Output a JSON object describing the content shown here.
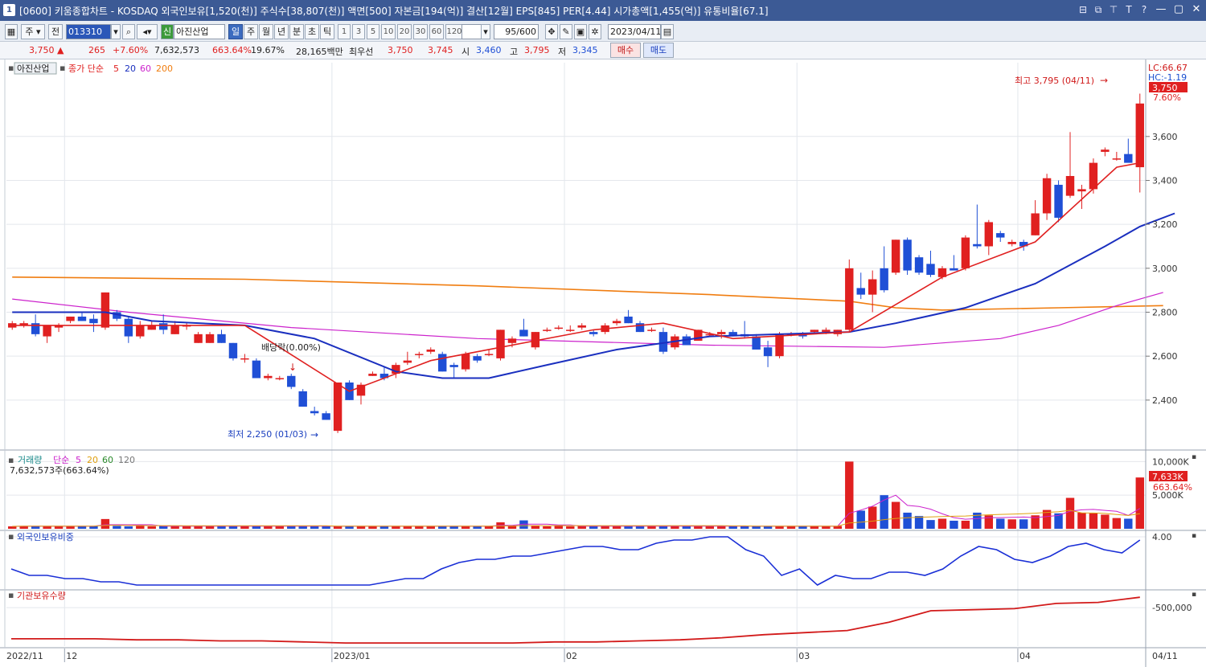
{
  "titlebar": {
    "window_number": "1",
    "title": "[0600] 키움종합차트 - KOSDAQ 외국인보유[1,520(천)] 주식수[38,807(천)] 액면[500] 자본금[194(억)] 결산[12월] EPS[845] PER[4.44] 시가총액[1,455(억)] 유통비율[67.1]",
    "icons": [
      "grid-icon",
      "window-icon",
      "pin-icon",
      "text-icon",
      "help-icon"
    ],
    "icon_glyphs": [
      "⊟",
      "⧉",
      "⊤",
      "T",
      "?"
    ],
    "controls": [
      "—",
      "▢",
      "✕"
    ]
  },
  "toolbar": {
    "unit_select": "주",
    "prev_button": "전",
    "stock_code": "013310",
    "credit_badge": "신",
    "stock_name": "아진산업",
    "period_buttons": [
      "일",
      "주",
      "월",
      "년",
      "분",
      "초",
      "틱"
    ],
    "active_period": "일",
    "interval_buttons": [
      "1",
      "3",
      "5",
      "10",
      "20",
      "30",
      "60",
      "120"
    ],
    "count_display": "95/600",
    "date_field": "2023/04/11"
  },
  "quote": {
    "price": "3,750 ▲",
    "change": "265",
    "change_pct": "+7.60%",
    "volume": "7,632,573",
    "volume_ratio": "663.64%",
    "turnover": "19.67%",
    "amount": "28,165백만",
    "best_ask_label": "최우선",
    "best_ask": "3,750",
    "best_bid": "3,745",
    "open_label": "시",
    "open": "3,460",
    "high_label": "고",
    "high": "3,795",
    "low_label": "저",
    "low": "3,345",
    "buy_button": "매수",
    "sell_button": "매도"
  },
  "colors": {
    "up": "#e02020",
    "down": "#1f4fd6",
    "ma5": "#e02020",
    "ma20": "#1a2fbf",
    "ma60": "#cc22cc",
    "ma200": "#f07d10",
    "foreign": "#1a2fd6",
    "institution": "#d21a1a"
  },
  "price_pane": {
    "stock_tag": "아진산업",
    "legend_prefix": "종가 단순",
    "legend_periods": [
      "5",
      "20",
      "60",
      "200"
    ],
    "lc_label": "LC:66.67",
    "hc_label": "HC:-1.19",
    "current_price_tag": "3,750",
    "current_pct_tag": "7.60%",
    "high_annotation": "최고 3,795 (04/11)",
    "low_annotation": "최저 2,250 (01/03)",
    "dividend_annotation": "배당락(0.00%)"
  },
  "volume_pane": {
    "title": "거래량",
    "legend_prefix": "단순",
    "legend_periods": [
      "5",
      "20",
      "60",
      "120"
    ],
    "value_text": "7,632,573주(663.64%)",
    "current_tag": "7,633K",
    "current_pct": "663.64%"
  },
  "foreign_pane": {
    "title": "외국인보유비중",
    "tick": "4.00"
  },
  "institution_pane": {
    "title": "기관보유수량",
    "tick": "-500,000"
  },
  "x_labels": [
    "2022/11",
    "12",
    "2023/01",
    "02",
    "03",
    "04",
    "04/11"
  ],
  "chart_data": [
    {
      "type": "candlestick",
      "title": "",
      "y_ticks": [
        2400,
        2600,
        2800,
        3000,
        3200,
        3400,
        3600
      ],
      "ylim": [
        2180,
        3870
      ],
      "x_labels": [
        "2022/11",
        "12",
        "2023/01",
        "02",
        "03",
        "04",
        "04/11"
      ],
      "candles": [
        [
          2730,
          2760,
          2720,
          2750
        ],
        [
          2740,
          2760,
          2730,
          2750
        ],
        [
          2750,
          2790,
          2690,
          2700
        ],
        [
          2690,
          2740,
          2660,
          2740
        ],
        [
          2730,
          2750,
          2710,
          2740
        ],
        [
          2760,
          2780,
          2750,
          2780
        ],
        [
          2780,
          2800,
          2760,
          2760
        ],
        [
          2770,
          2790,
          2710,
          2750
        ],
        [
          2730,
          2890,
          2720,
          2890
        ],
        [
          2800,
          2810,
          2760,
          2770
        ],
        [
          2770,
          2780,
          2660,
          2690
        ],
        [
          2690,
          2760,
          2680,
          2740
        ],
        [
          2720,
          2760,
          2720,
          2740
        ],
        [
          2750,
          2790,
          2700,
          2720
        ],
        [
          2700,
          2760,
          2700,
          2740
        ],
        [
          2740,
          2750,
          2720,
          2740
        ],
        [
          2660,
          2710,
          2660,
          2700
        ],
        [
          2660,
          2710,
          2660,
          2700
        ],
        [
          2700,
          2720,
          2660,
          2660
        ],
        [
          2660,
          2660,
          2580,
          2590
        ],
        [
          2590,
          2610,
          2570,
          2590
        ],
        [
          2580,
          2590,
          2500,
          2500
        ],
        [
          2500,
          2520,
          2490,
          2510
        ],
        [
          2500,
          2510,
          2490,
          2500
        ],
        [
          2510,
          2520,
          2450,
          2460
        ],
        [
          2440,
          2450,
          2370,
          2370
        ],
        [
          2350,
          2370,
          2330,
          2340
        ],
        [
          2340,
          2350,
          2310,
          2310
        ],
        [
          2260,
          2480,
          2250,
          2480
        ],
        [
          2480,
          2490,
          2400,
          2400
        ],
        [
          2420,
          2480,
          2380,
          2470
        ],
        [
          2510,
          2530,
          2510,
          2520
        ],
        [
          2520,
          2550,
          2490,
          2500
        ],
        [
          2520,
          2570,
          2500,
          2560
        ],
        [
          2570,
          2620,
          2560,
          2580
        ],
        [
          2610,
          2620,
          2590,
          2610
        ],
        [
          2620,
          2640,
          2610,
          2630
        ],
        [
          2610,
          2620,
          2530,
          2530
        ],
        [
          2560,
          2570,
          2500,
          2550
        ],
        [
          2540,
          2620,
          2530,
          2610
        ],
        [
          2600,
          2610,
          2570,
          2580
        ],
        [
          2610,
          2630,
          2600,
          2610
        ],
        [
          2590,
          2720,
          2580,
          2720
        ],
        [
          2660,
          2690,
          2640,
          2680
        ],
        [
          2720,
          2770,
          2690,
          2690
        ],
        [
          2640,
          2710,
          2630,
          2710
        ],
        [
          2720,
          2730,
          2710,
          2720
        ],
        [
          2730,
          2740,
          2720,
          2730
        ],
        [
          2720,
          2740,
          2710,
          2720
        ],
        [
          2730,
          2750,
          2720,
          2740
        ],
        [
          2710,
          2720,
          2690,
          2700
        ],
        [
          2710,
          2750,
          2700,
          2740
        ],
        [
          2750,
          2770,
          2740,
          2760
        ],
        [
          2780,
          2810,
          2750,
          2750
        ],
        [
          2750,
          2760,
          2710,
          2710
        ],
        [
          2720,
          2730,
          2710,
          2720
        ],
        [
          2710,
          2730,
          2610,
          2620
        ],
        [
          2640,
          2700,
          2630,
          2690
        ],
        [
          2690,
          2700,
          2650,
          2650
        ],
        [
          2670,
          2720,
          2670,
          2720
        ],
        [
          2700,
          2710,
          2690,
          2700
        ],
        [
          2700,
          2720,
          2680,
          2710
        ],
        [
          2710,
          2720,
          2690,
          2690
        ],
        [
          2700,
          2760,
          2680,
          2690
        ],
        [
          2690,
          2700,
          2630,
          2630
        ],
        [
          2640,
          2670,
          2550,
          2600
        ],
        [
          2600,
          2710,
          2590,
          2700
        ],
        [
          2700,
          2710,
          2690,
          2700
        ],
        [
          2700,
          2710,
          2680,
          2690
        ],
        [
          2710,
          2720,
          2700,
          2720
        ],
        [
          2710,
          2730,
          2700,
          2720
        ],
        [
          2700,
          2720,
          2690,
          2720
        ],
        [
          2720,
          3040,
          2710,
          3000
        ],
        [
          2910,
          2980,
          2860,
          2880
        ],
        [
          2880,
          2990,
          2800,
          2950
        ],
        [
          3000,
          3100,
          2890,
          2900
        ],
        [
          2980,
          3130,
          2970,
          3130
        ],
        [
          3130,
          3140,
          2970,
          2990
        ],
        [
          3050,
          3060,
          2970,
          2980
        ],
        [
          3020,
          3080,
          2960,
          2970
        ],
        [
          2960,
          3010,
          2950,
          3000
        ],
        [
          3000,
          3060,
          2990,
          2990
        ],
        [
          3000,
          3150,
          2990,
          3140
        ],
        [
          3110,
          3290,
          3090,
          3100
        ],
        [
          3100,
          3220,
          3060,
          3210
        ],
        [
          3160,
          3170,
          3120,
          3140
        ],
        [
          3110,
          3130,
          3100,
          3120
        ],
        [
          3120,
          3130,
          3080,
          3100
        ],
        [
          3150,
          3310,
          3150,
          3250
        ],
        [
          3250,
          3430,
          3220,
          3410
        ],
        [
          3380,
          3400,
          3210,
          3230
        ],
        [
          3330,
          3620,
          3320,
          3420
        ],
        [
          3350,
          3380,
          3270,
          3360
        ],
        [
          3360,
          3500,
          3340,
          3480
        ],
        [
          3530,
          3550,
          3510,
          3540
        ],
        [
          3500,
          3530,
          3490,
          3500
        ],
        [
          3520,
          3590,
          3500,
          3480
        ],
        [
          3460,
          3795,
          3345,
          3750
        ]
      ],
      "ma_lines": [
        {
          "name": "5",
          "points": [
            [
              0,
              2740
            ],
            [
              20,
              2740
            ],
            [
              23,
              2640
            ],
            [
              29,
              2440
            ],
            [
              36,
              2580
            ],
            [
              42,
              2640
            ],
            [
              50,
              2720
            ],
            [
              56,
              2750
            ],
            [
              62,
              2680
            ],
            [
              72,
              2710
            ],
            [
              80,
              2960
            ],
            [
              88,
              3120
            ],
            [
              95,
              3460
            ],
            [
              97,
              3480
            ]
          ]
        },
        {
          "name": "20",
          "points": [
            [
              0,
              2800
            ],
            [
              8,
              2800
            ],
            [
              12,
              2760
            ],
            [
              20,
              2740
            ],
            [
              26,
              2680
            ],
            [
              33,
              2530
            ],
            [
              37,
              2500
            ],
            [
              41,
              2500
            ],
            [
              46,
              2560
            ],
            [
              52,
              2630
            ],
            [
              60,
              2690
            ],
            [
              72,
              2710
            ],
            [
              76,
              2750
            ],
            [
              82,
              2820
            ],
            [
              88,
              2930
            ],
            [
              94,
              3100
            ],
            [
              97,
              3190
            ],
            [
              100,
              3250
            ]
          ]
        },
        {
          "name": "60",
          "points": [
            [
              0,
              2860
            ],
            [
              10,
              2800
            ],
            [
              24,
              2730
            ],
            [
              40,
              2680
            ],
            [
              60,
              2650
            ],
            [
              75,
              2640
            ],
            [
              85,
              2680
            ],
            [
              90,
              2740
            ],
            [
              95,
              2830
            ],
            [
              99,
              2890
            ]
          ]
        },
        {
          "name": "200",
          "points": [
            [
              0,
              2960
            ],
            [
              20,
              2950
            ],
            [
              40,
              2920
            ],
            [
              60,
              2880
            ],
            [
              72,
              2850
            ],
            [
              76,
              2820
            ],
            [
              80,
              2810
            ],
            [
              90,
              2820
            ],
            [
              99,
              2830
            ]
          ]
        }
      ]
    },
    {
      "type": "bar",
      "title": "거래량",
      "ylim": [
        0,
        11000
      ],
      "y_ticks": [
        5000,
        10000
      ],
      "values": [
        360,
        420,
        360,
        420,
        360,
        420,
        360,
        420,
        1450,
        420,
        360,
        420,
        360,
        420,
        360,
        420,
        360,
        420,
        360,
        420,
        360,
        420,
        360,
        420,
        360,
        420,
        360,
        420,
        360,
        420,
        360,
        420,
        360,
        420,
        360,
        420,
        360,
        420,
        360,
        420,
        360,
        420,
        960,
        420,
        1250,
        420,
        360,
        420,
        360,
        420,
        360,
        420,
        360,
        420,
        360,
        420,
        360,
        420,
        360,
        420,
        360,
        420,
        360,
        420,
        360,
        420,
        360,
        420,
        360,
        420,
        360,
        420,
        10000,
        2700,
        3300,
        5000,
        4000,
        2400,
        1900,
        1300,
        1500,
        1200,
        1200,
        2400,
        2000,
        1500,
        1400,
        1400,
        2000,
        2800,
        2300,
        4600,
        2400,
        2300,
        2100,
        1600,
        1500,
        7633
      ]
    },
    {
      "type": "line",
      "title": "외국인보유비중",
      "y_ticks": [
        4.0
      ],
      "values": [
        3.0,
        2.8,
        2.8,
        2.7,
        2.7,
        2.6,
        2.6,
        2.5,
        2.5,
        2.5,
        2.5,
        2.5,
        2.5,
        2.5,
        2.5,
        2.5,
        2.5,
        2.5,
        2.5,
        2.5,
        2.5,
        2.6,
        2.7,
        2.7,
        3.0,
        3.2,
        3.3,
        3.3,
        3.4,
        3.4,
        3.5,
        3.6,
        3.7,
        3.7,
        3.6,
        3.6,
        3.8,
        3.9,
        3.9,
        4.0,
        4.0,
        3.6,
        3.4,
        2.8,
        3.0,
        2.5,
        2.8,
        2.7,
        2.7,
        2.9,
        2.9,
        2.8,
        3.0,
        3.4,
        3.7,
        3.6,
        3.3,
        3.2,
        3.4,
        3.7,
        3.8,
        3.6,
        3.5,
        3.9
      ]
    },
    {
      "type": "line",
      "title": "기관보유수량",
      "y_ticks": [
        -500000
      ],
      "values": [
        -800000,
        -800000,
        -800000,
        -810000,
        -810000,
        -820000,
        -820000,
        -830000,
        -840000,
        -840000,
        -840000,
        -840000,
        -840000,
        -830000,
        -830000,
        -820000,
        -810000,
        -790000,
        -760000,
        -740000,
        -720000,
        -640000,
        -530000,
        -520000,
        -510000,
        -460000,
        -450000,
        -400000
      ]
    }
  ]
}
